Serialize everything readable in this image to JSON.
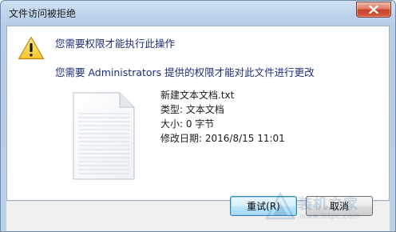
{
  "window": {
    "title": "文件访问被拒绝"
  },
  "message": {
    "primary": "您需要权限才能执行此操作",
    "secondary": "您需要 Administrators 提供的权限才能对此文件进行更改"
  },
  "file": {
    "name": "新建文本文档.txt",
    "type": "类型: 文本文档",
    "size": "大小: 0 字节",
    "modified": "修改日期: 2016/8/15 11:01"
  },
  "buttons": {
    "retry": "重试(R)",
    "cancel": "取消"
  },
  "watermark": {
    "name": "装机之家",
    "url": "www.lotpc.com"
  },
  "icons": {
    "warning": "warning-triangle-icon",
    "document": "text-document-icon",
    "close": "close-icon"
  }
}
